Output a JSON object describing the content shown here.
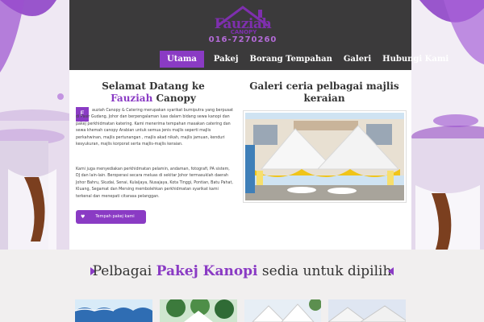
{
  "header": {
    "logo_name": "Fauziah",
    "logo_sub": "CANOPY",
    "logo_phone": "016-7270260",
    "icon": "house-roof-icon"
  },
  "nav": {
    "items": [
      {
        "label": "Utama",
        "active": true
      },
      {
        "label": "Pakej",
        "active": false
      },
      {
        "label": "Borang Tempahan",
        "active": false
      },
      {
        "label": "Galeri",
        "active": false
      },
      {
        "label": "Hubungi Kami",
        "active": false
      }
    ]
  },
  "welcome": {
    "title_line1": "Selamat Datang ke",
    "brand": "Fauziah",
    "title_rest": " Canopy",
    "dropcap": "F",
    "paragraph1": "auziah Canopy & Catering merupakan syarikat bumiputra yang berpusat di Pasir Gudang, Johor dan berpengalaman luas dalam bidang sewa kanopi dan pakej perkhidmatan katering. Kami menerima tempahan masakan catering dan sewa khemah canopy Arabian untuk semua jenis majlis seperti majlis perkahwinan, majlis pertunangan , majlis akad nikah, majlis jamuan, kenduri kesyukuran, majlis korporat serta majlis-majlis keraian.",
    "paragraph2": "Kami juga menyediakan perkhidmatan pelamin, andaman, fotografi, PA sistem, DJ dan lain-lain. Beroperasi secara meluas di sekitar Johor termasuklah daerah Johor Bahru, Skudai, Senai, Kulaijaya, Nusajaya, Kota Tinggi, Pontian, Batu Pahat, Kluang, Segamat dan Mersing membolehkan perkhidmatan syarikat kami terkenal dan menepati citarasa pelanggan.",
    "button_label": "Tempah pakej kami",
    "button_icon": "heart-icon"
  },
  "gallery": {
    "title": "Galeri ceria pelbagai majlis keraian"
  },
  "packages": {
    "heading_pre": "Pelbagai ",
    "heading_highlight": "Pakej Kanopi",
    "heading_post": " sedia untuk dipilih"
  },
  "colors": {
    "accent": "#8a3bc4",
    "header_bg": "#3b3a3b"
  }
}
